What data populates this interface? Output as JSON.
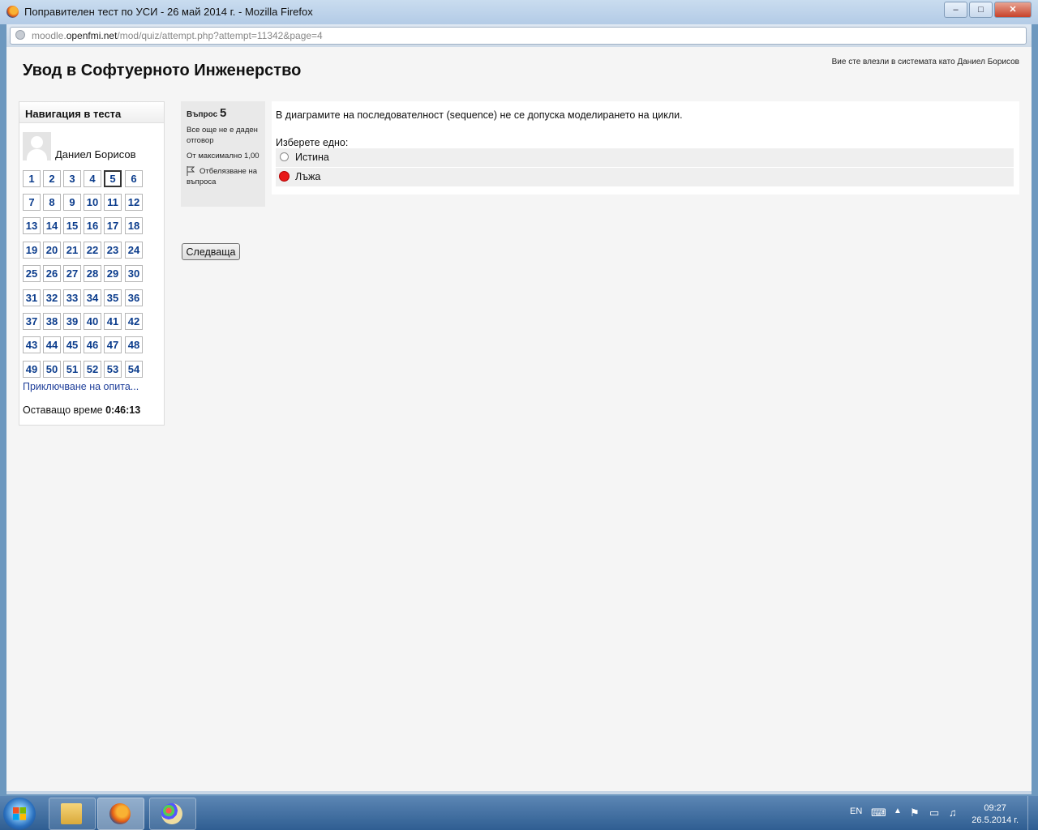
{
  "window": {
    "title": "Поправителен тест по УСИ - 26 май 2014 г. - Mozilla Firefox",
    "min_label": "–",
    "max_label": "□",
    "close_label": "✕"
  },
  "urlbar": {
    "url_prefix": "moodle.",
    "url_domain": "openfmi.net",
    "url_path": "/mod/quiz/attempt.php?attempt=11342&page=4"
  },
  "page": {
    "course_title": "Увод в Софтуерното Инженерство",
    "login_info": "Вие сте влезли в системата като Даниел Борисов"
  },
  "nav": {
    "header": "Навигация в теста",
    "user_name": "Даниел Борисов",
    "questions": [
      "1",
      "2",
      "3",
      "4",
      "5",
      "6",
      "7",
      "8",
      "9",
      "10",
      "11",
      "12",
      "13",
      "14",
      "15",
      "16",
      "17",
      "18",
      "19",
      "20",
      "21",
      "22",
      "23",
      "24",
      "25",
      "26",
      "27",
      "28",
      "29",
      "30",
      "31",
      "32",
      "33",
      "34",
      "35",
      "36",
      "37",
      "38",
      "39",
      "40",
      "41",
      "42",
      "43",
      "44",
      "45",
      "46",
      "47",
      "48",
      "49",
      "50",
      "51",
      "52",
      "53",
      "54"
    ],
    "current_question": "5",
    "finish_link": "Приключване на опита...",
    "time_label": "Оставащо време",
    "time_value": "0:46:13"
  },
  "question": {
    "label": "Въпрос",
    "number": "5",
    "status": "Все още не е даден отговор",
    "max_points": "От максимално 1,00",
    "flag_label": "Отбелязване на въпроса",
    "text": "В диаграмите на последователност (sequence) не се допуска моделирането на цикли.",
    "prompt": "Изберете едно:",
    "answers": [
      {
        "label": "Истина",
        "selected": false
      },
      {
        "label": "Лъжа",
        "selected": true
      }
    ]
  },
  "buttons": {
    "next": "Следваща"
  },
  "taskbar": {
    "apps": [
      "folder-icon",
      "firefox-icon",
      "paint-icon"
    ],
    "lang": "EN",
    "time": "09:27",
    "date": "26.5.2014 г."
  }
}
